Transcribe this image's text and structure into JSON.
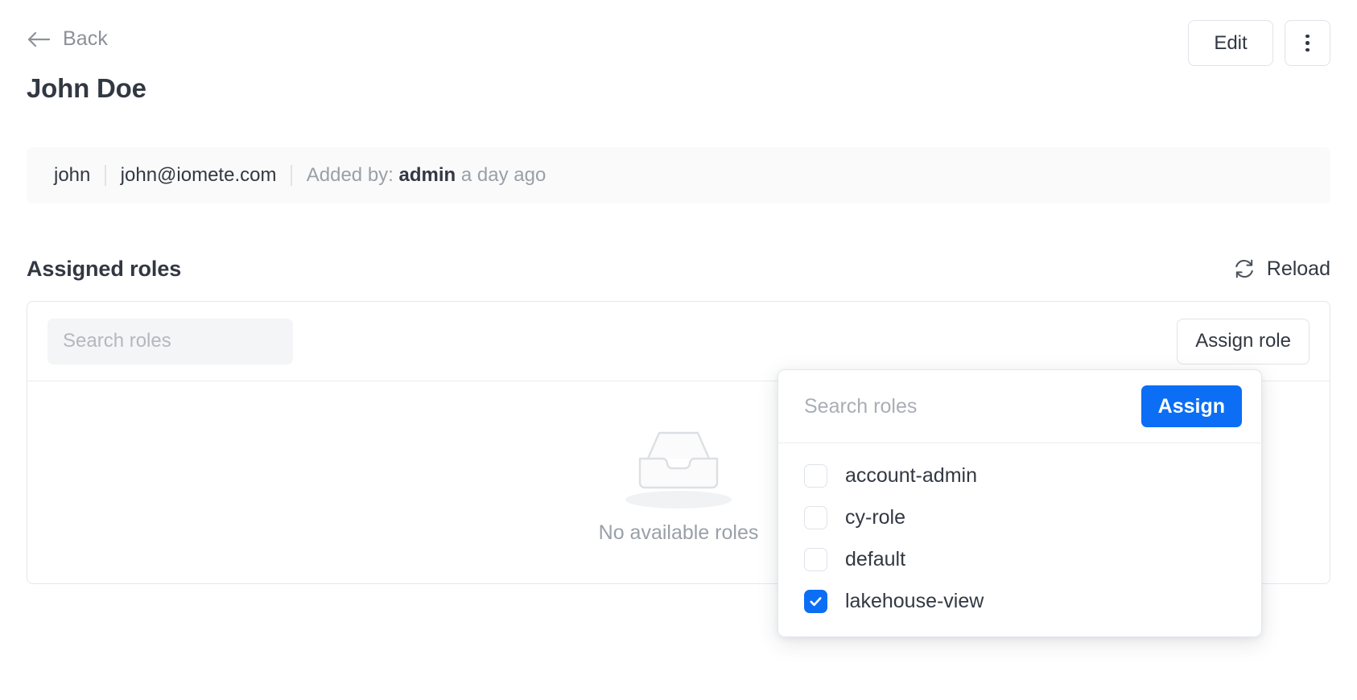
{
  "header": {
    "back_label": "Back",
    "back_icon": "arrow-left-icon",
    "title": "John Doe",
    "edit_label": "Edit",
    "kebab_icon": "more-vertical-icon"
  },
  "info_bar": {
    "username": "john",
    "email": "john@iomete.com",
    "added_by_prefix": "Added by:",
    "added_by_user": "admin",
    "added_time": "a day ago"
  },
  "section": {
    "title": "Assigned roles",
    "reload_label": "Reload",
    "reload_icon": "refresh-icon"
  },
  "card": {
    "search_placeholder": "Search roles",
    "search_value": "",
    "assign_role_label": "Assign role",
    "empty_icon": "empty-inbox-icon",
    "empty_text": "No available roles"
  },
  "dropdown": {
    "search_placeholder": "Search roles",
    "search_value": "",
    "assign_label": "Assign",
    "roles": [
      {
        "label": "account-admin",
        "checked": false
      },
      {
        "label": "cy-role",
        "checked": false
      },
      {
        "label": "default",
        "checked": false
      },
      {
        "label": "lakehouse-view",
        "checked": true
      }
    ]
  },
  "colors": {
    "accent": "#0b6ef5",
    "text": "#323842",
    "muted": "#9aa0a8",
    "border": "#e3e7ec",
    "info_bg": "#fafafb",
    "field_bg": "#f4f5f7"
  }
}
